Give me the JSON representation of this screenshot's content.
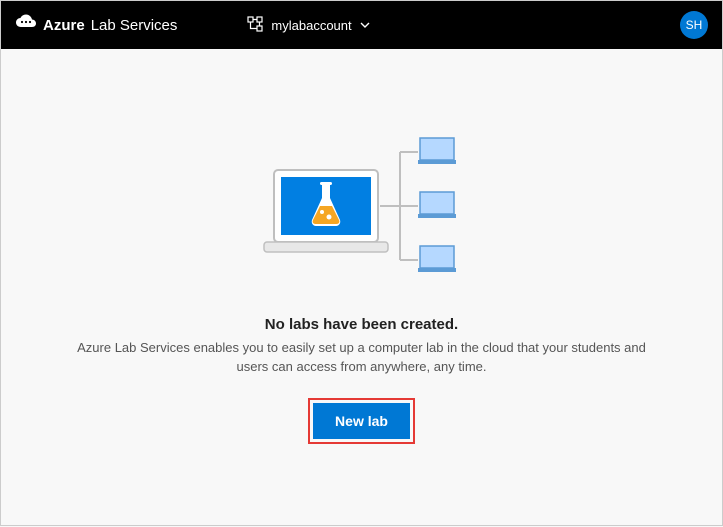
{
  "header": {
    "brand_bold": "Azure",
    "brand_light": "Lab Services",
    "account_name": "mylabaccount",
    "user_initials": "SH"
  },
  "empty": {
    "title": "No labs have been created.",
    "description": "Azure Lab Services enables you to easily set up a computer lab in the cloud that your students and users can access from anywhere, any time.",
    "button_label": "New lab"
  },
  "illustration": {
    "flask": "#f5a623",
    "laptop_screen": "#017fe2",
    "device_border": "#bfbfbf",
    "monitor_fill": "#b5d8ff",
    "monitor_border": "#5c9bd5"
  }
}
